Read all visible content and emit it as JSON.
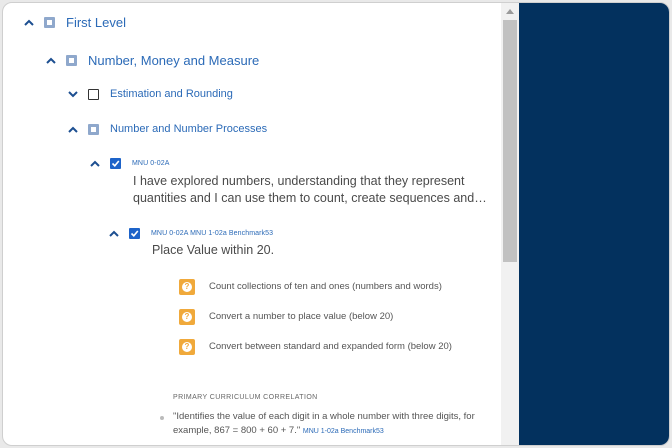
{
  "tree": {
    "first_level": "First Level",
    "number_money_measure": "Number, Money and Measure",
    "estimation_rounding": "Estimation and Rounding",
    "number_processes": "Number and Number Processes",
    "outcome_code": "MNU 0-02A",
    "outcome_text": "I have explored numbers, understanding that they represent quantities and I can use them to count, create sequences and…",
    "benchmark_code": "MNU 0-02A MNU 1-02a Benchmark53",
    "benchmark_title": "Place Value within 20.",
    "items": [
      {
        "text": "Count collections of ten and ones (numbers and words)"
      },
      {
        "text": "Convert a number to place value (below 20)"
      },
      {
        "text": "Convert between standard and expanded form (below 20)"
      }
    ],
    "correlation_title": "PRIMARY CURRICULUM CORRELATION",
    "correlation_quote": "\"Identifies the value of each digit in a whole number with three digits, for example, 867 = 800 + 60 + 7.\"",
    "correlation_ref": "MNU 1-02a Benchmark53"
  },
  "colors": {
    "accent": "#2b6ab7",
    "checkbox_checked": "#1d63c9",
    "panel": "#03315e",
    "question_icon": "#f0a93b"
  }
}
